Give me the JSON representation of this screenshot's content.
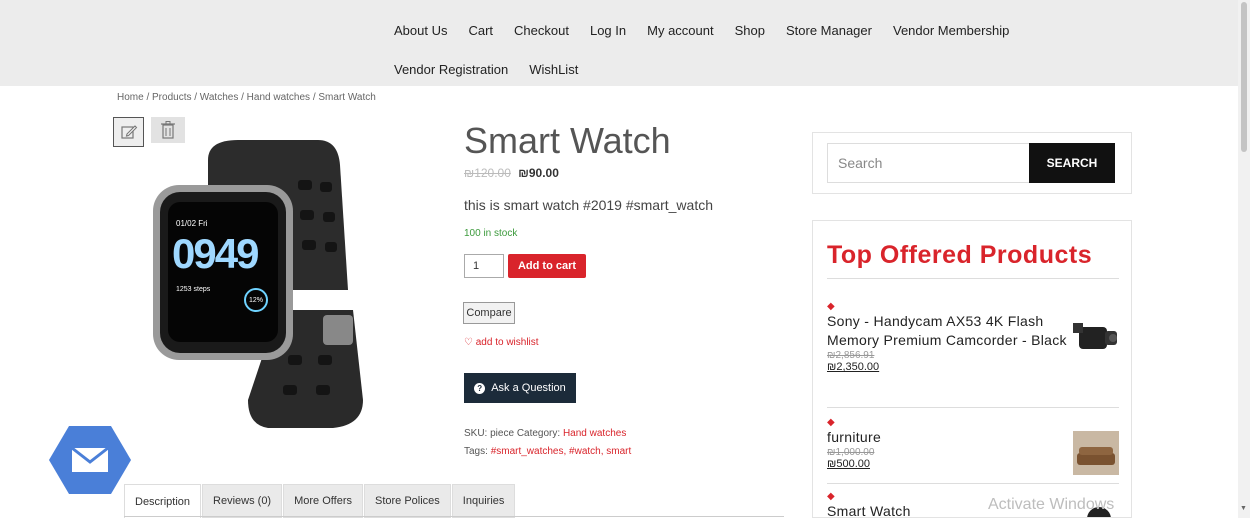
{
  "nav": {
    "row1": [
      "About Us",
      "Cart",
      "Checkout",
      "Log In",
      "My account",
      "Shop",
      "Store Manager",
      "Vendor Membership"
    ],
    "row2": [
      "Vendor Registration",
      "WishList"
    ]
  },
  "breadcrumb": "Home / Products / Watches / Hand watches / Smart Watch",
  "product": {
    "title": "Smart Watch",
    "old_price": "₪120.00",
    "new_price": "₪90.00",
    "description": "this is smart watch #2019 #smart_watch",
    "stock": "100 in stock",
    "quantity": "1",
    "add_to_cart": "Add to cart",
    "compare": "Compare",
    "wishlist": "♡ add to wishlist",
    "ask_question": "Ask a Question",
    "sku_label": "SKU: piece",
    "category_label": "Category:",
    "category": "Hand watches",
    "tags_label": "Tags:",
    "tags": "#smart_watches, #watch, smart",
    "watch_screen": {
      "date": "01/02 Fri",
      "time": "0949",
      "steps": "1253 steps",
      "pct": "12%"
    }
  },
  "tabs": [
    "Description",
    "Reviews (0)",
    "More Offers",
    "Store Polices",
    "Inquiries"
  ],
  "search": {
    "placeholder": "Search",
    "button": "SEARCH"
  },
  "widget": {
    "title": "Top Offered Products",
    "items": [
      {
        "name": "Sony - Handycam AX53 4K Flash Memory Premium Camcorder - Black",
        "old_price": "₪2,856.91",
        "new_price": "₪2,350.00"
      },
      {
        "name": "furniture",
        "old_price": "₪1,000.00",
        "new_price": "₪500.00"
      },
      {
        "name": "Smart Watch"
      }
    ]
  },
  "watermark": "Activate Windows",
  "colors": {
    "accent": "#d9242b",
    "dark_button": "#1c2b3a",
    "nav_bg": "#ececec"
  }
}
